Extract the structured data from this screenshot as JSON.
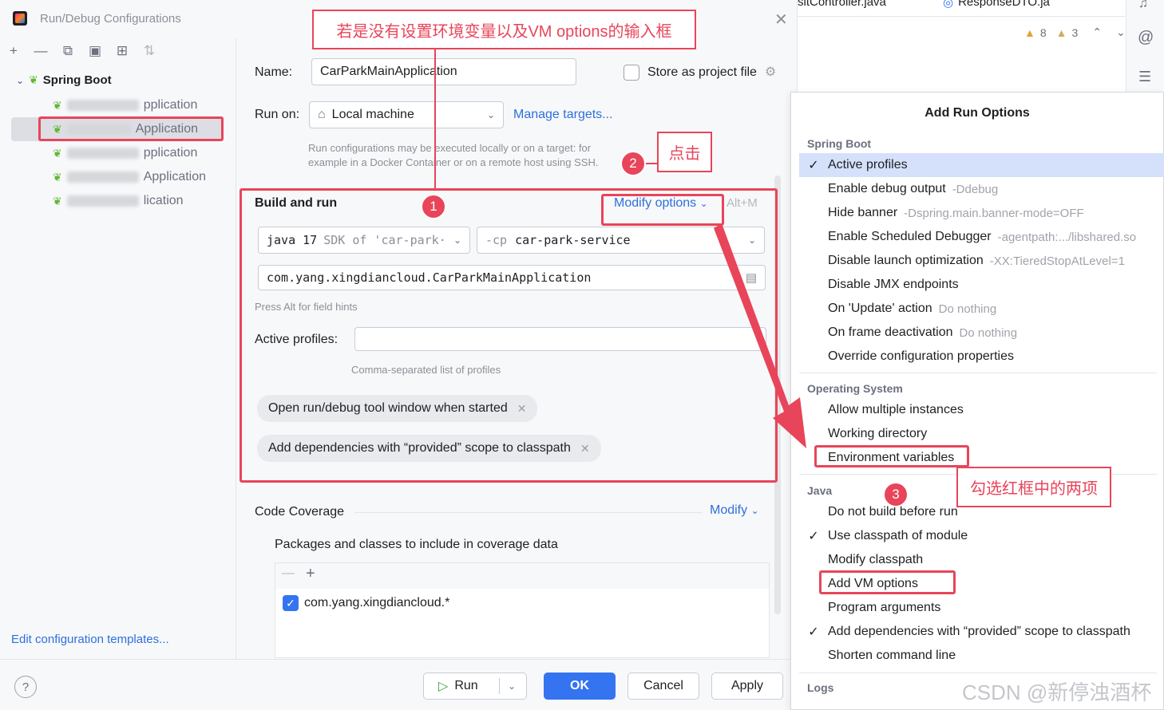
{
  "dialog": {
    "title": "Run/Debug Configurations",
    "close_icon": "close-icon"
  },
  "tree": {
    "root_label": "Spring Boot",
    "items": [
      {
        "suffix": "pplication"
      },
      {
        "suffix": "Application"
      },
      {
        "suffix": "pplication"
      },
      {
        "suffix": "Application"
      },
      {
        "suffix": "lication"
      }
    ],
    "edit_templates": "Edit configuration templates..."
  },
  "form": {
    "name_label": "Name:",
    "name_value": "CarParkMainApplication",
    "store_label": "Store as project file",
    "run_on_label": "Run on:",
    "run_on_value": "Local machine",
    "manage_targets": "Manage targets...",
    "run_hint_1": "Run configurations may be executed locally or on a target: for",
    "run_hint_2": "example in a Docker Container or on a remote host using SSH.",
    "build_run_title": "Build and run",
    "modify_options": "Modify options",
    "modify_shortcut": "Alt+M",
    "sdk_value_main": "java 17",
    "sdk_value_rest": "SDK of 'car-park·",
    "cp_prefix": "-cp",
    "cp_value": "car-park-service",
    "main_class": "com.yang.xingdiancloud.CarParkMainApplication",
    "field_hint": "Press Alt for field hints",
    "active_profiles_label": "Active profiles:",
    "active_profiles_value": "",
    "profiles_hint": "Comma-separated list of profiles",
    "chip_1": "Open run/debug tool window when started",
    "chip_2": "Add dependencies with “provided” scope to classpath",
    "code_coverage": "Code Coverage",
    "modify_link": "Modify",
    "packages_label": "Packages and classes to include in coverage data",
    "coverage_entry": "com.yang.xingdiancloud.*"
  },
  "buttons": {
    "run": "Run",
    "ok": "OK",
    "cancel": "Cancel",
    "apply": "Apply",
    "help": "?"
  },
  "annotations": {
    "callout_top": "若是没有设置环境变量以及VM options的输入框",
    "callout_click": "点击",
    "callout_check": "勾选红框中的两项",
    "badge_1": "1",
    "badge_2": "2",
    "badge_3": "3",
    "accent_color": "#e8455a"
  },
  "editor_strip": {
    "tab_1": "sitController.java",
    "tab_2": "ResponseDTO.ja",
    "warn_count": "8",
    "weak_warn_count": "3"
  },
  "popup": {
    "title": "Add Run Options",
    "sections": [
      {
        "header": "Spring Boot",
        "options": [
          {
            "label": "Active profiles",
            "hint": "",
            "checked": "✓"
          },
          {
            "label": "Enable debug output",
            "hint": "-Ddebug",
            "checked": ""
          },
          {
            "label": "Hide banner",
            "hint": "-Dspring.main.banner-mode=OFF",
            "checked": ""
          },
          {
            "label": "Enable Scheduled Debugger",
            "hint": "-agentpath:.../libshared.so",
            "checked": ""
          },
          {
            "label": "Disable launch optimization",
            "hint": "-XX:TieredStopAtLevel=1",
            "checked": ""
          },
          {
            "label": "Disable JMX endpoints",
            "hint": "",
            "checked": ""
          },
          {
            "label": "On 'Update' action",
            "hint": "Do nothing",
            "checked": ""
          },
          {
            "label": "On frame deactivation",
            "hint": "Do nothing",
            "checked": ""
          },
          {
            "label": "Override configuration properties",
            "hint": "",
            "checked": ""
          }
        ]
      },
      {
        "header": "Operating System",
        "options": [
          {
            "label": "Allow multiple instances",
            "hint": "",
            "checked": ""
          },
          {
            "label": "Working directory",
            "hint": "",
            "checked": ""
          },
          {
            "label": "Environment variables",
            "hint": "",
            "checked": ""
          }
        ]
      },
      {
        "header": "Java",
        "options": [
          {
            "label": "Do not build before run",
            "hint": "",
            "checked": ""
          },
          {
            "label": "Use classpath of module",
            "hint": "",
            "checked": "✓"
          },
          {
            "label": "Modify classpath",
            "hint": "",
            "checked": ""
          },
          {
            "label": "Add VM options",
            "hint": "",
            "checked": ""
          },
          {
            "label": "Program arguments",
            "hint": "",
            "checked": ""
          },
          {
            "label": "Add dependencies with “provided” scope to classpath",
            "hint": "",
            "checked": "✓"
          },
          {
            "label": "Shorten command line",
            "hint": "",
            "checked": ""
          }
        ]
      },
      {
        "header": "Logs",
        "options": []
      }
    ]
  },
  "watermark": "CSDN @新停浊酒杯"
}
